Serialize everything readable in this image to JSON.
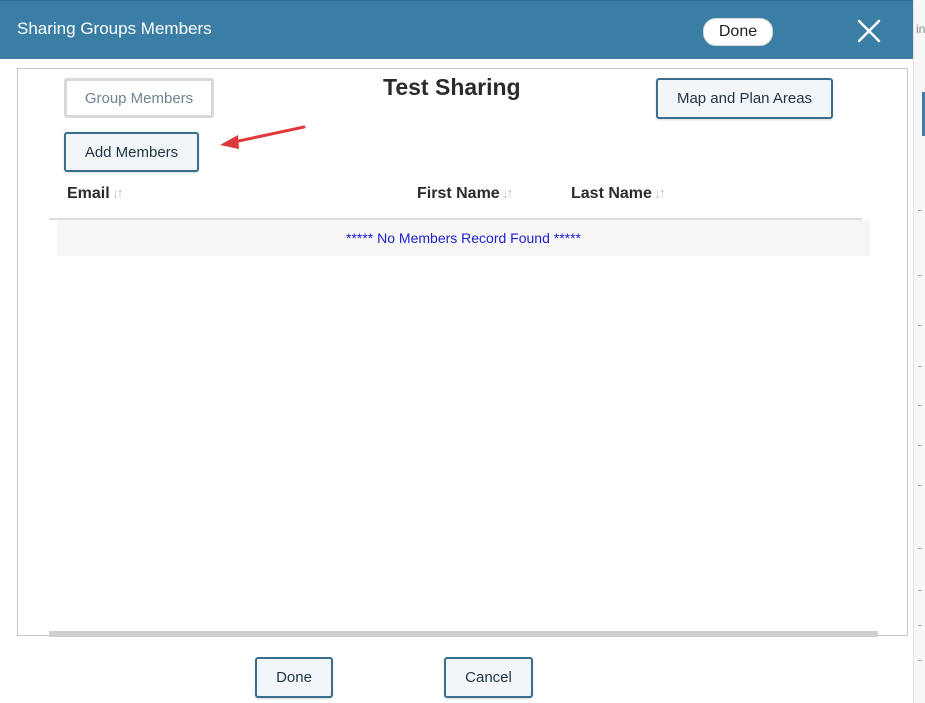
{
  "dialog": {
    "title": "Sharing Groups Members",
    "top_done_label": "Done"
  },
  "panel": {
    "heading": "Test Sharing",
    "group_members_label": "Group Members",
    "add_members_label": "Add Members",
    "map_plan_label": "Map and Plan Areas"
  },
  "table": {
    "columns": [
      "Email",
      "First Name",
      "Last Name"
    ],
    "sort_glyph": "↓↑",
    "empty_message": "***** No Members Record Found *****"
  },
  "footer": {
    "done_label": "Done",
    "cancel_label": "Cancel"
  },
  "background": {
    "partial_text": "in"
  },
  "colors": {
    "titlebar": "#3a7ea6",
    "annotation_arrow": "#e0393b",
    "empty_message": "#2222cc"
  },
  "icons": [
    "close-icon",
    "sort-icon",
    "annotation-arrow"
  ]
}
